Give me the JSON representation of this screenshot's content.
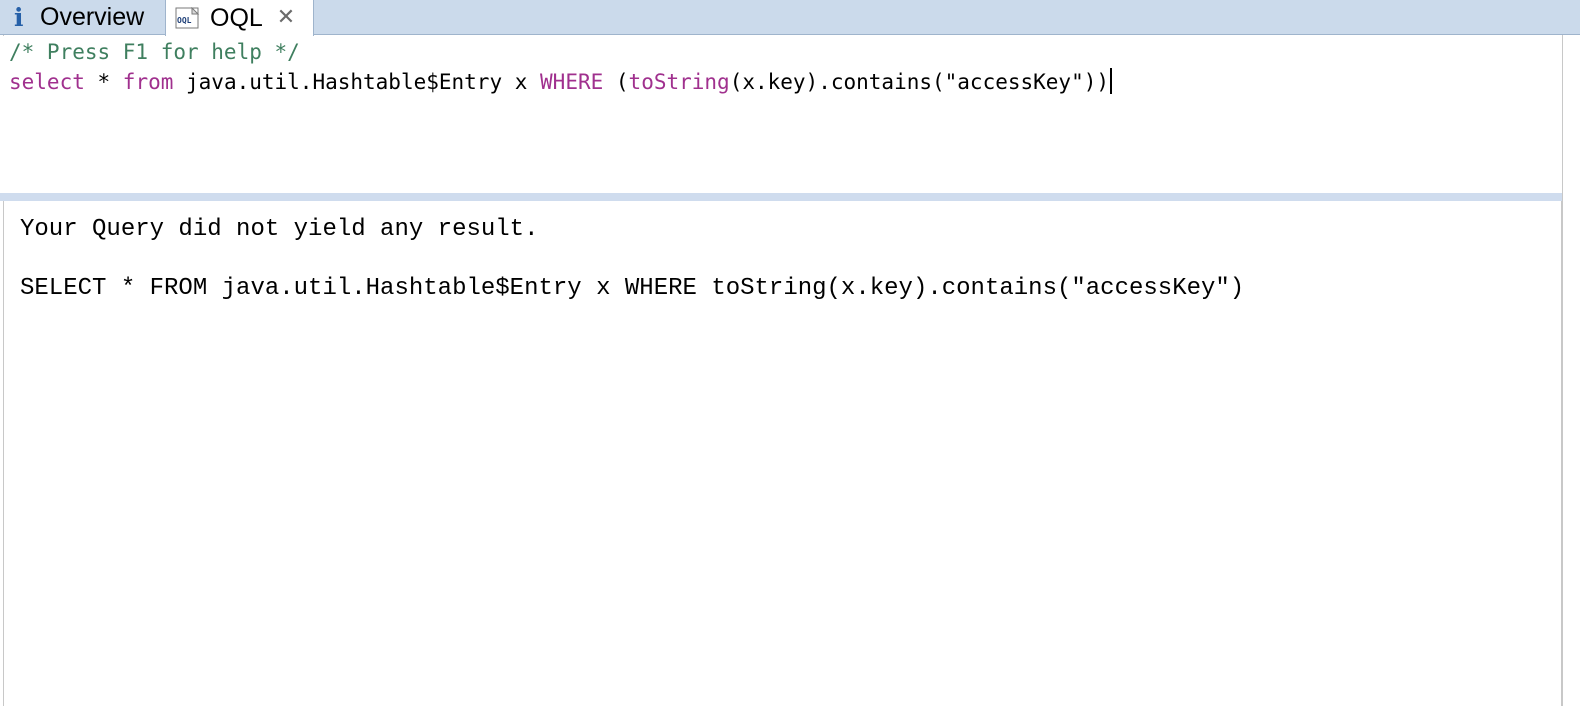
{
  "tabs": {
    "overview": {
      "label": "Overview",
      "icon": "info-icon",
      "icon_glyph": "i"
    },
    "oql": {
      "label": "OQL",
      "icon": "oql-file-icon",
      "icon_text": "OQL",
      "close_icon": "close-icon",
      "close_glyph": "✕"
    }
  },
  "editor": {
    "line1": {
      "comment": "/* Press F1 for help */"
    },
    "line2": {
      "kw_select": "select",
      "star": " * ",
      "kw_from": "from",
      "class_part": " java.util.Hashtable$Entry x ",
      "kw_where": "WHERE",
      "paren_open": " (",
      "fn_tostring": "toString",
      "rest": "(x.key).contains(\"accessKey\"))"
    }
  },
  "results": {
    "message": "Your Query did not yield any result.",
    "query": "SELECT * FROM java.util.Hashtable$Entry x WHERE toString(x.key).contains(\"accessKey\")"
  },
  "colors": {
    "tabbar_bg": "#cbdaeb",
    "comment": "#3f7f5f",
    "keyword": "#a0308e",
    "sash": "#cfdcee"
  }
}
